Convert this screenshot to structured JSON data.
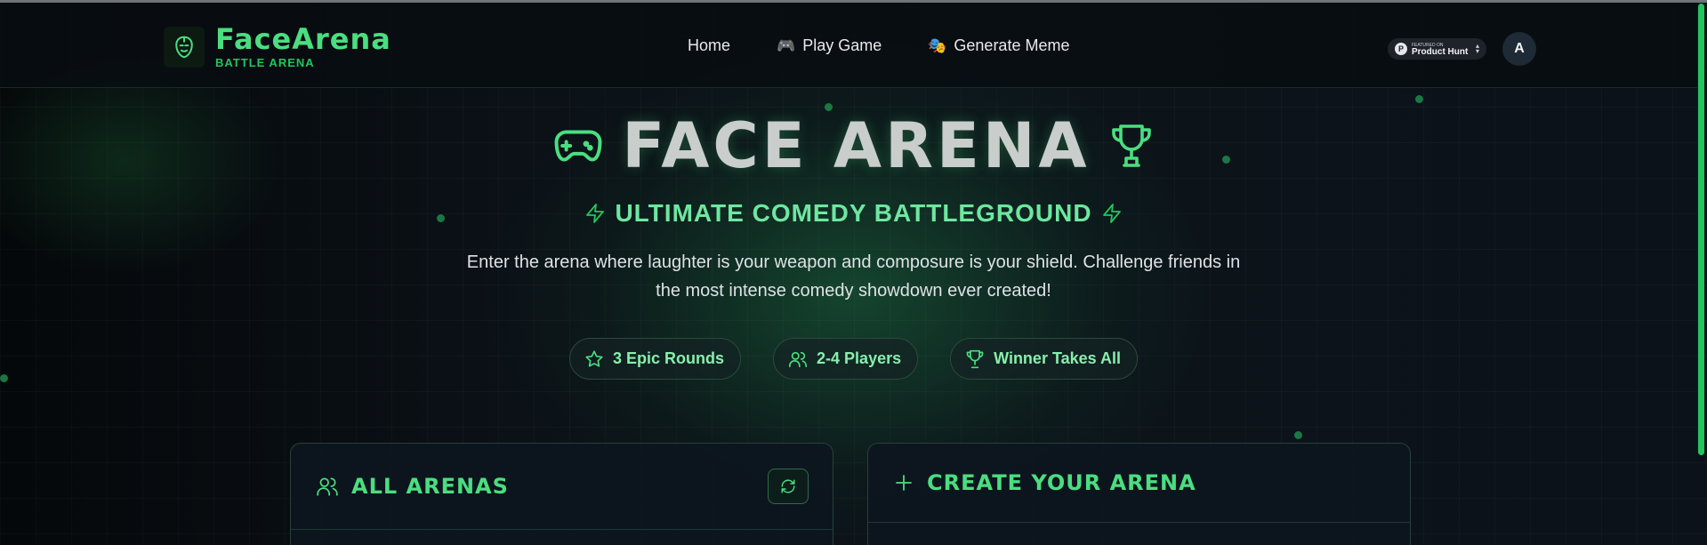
{
  "brand": {
    "title": "FaceArena",
    "subtitle": "BATTLE ARENA",
    "logo_icon": "mask-face-icon"
  },
  "nav": {
    "links": [
      {
        "label": "Home",
        "icon": ""
      },
      {
        "label": "Play Game",
        "icon": "🎮"
      },
      {
        "label": "Generate Meme",
        "icon": "🎭"
      }
    ]
  },
  "product_hunt": {
    "small_text": "FEATURED ON",
    "label": "Product Hunt",
    "logo_letter": "P",
    "arrows": "▲\n▼"
  },
  "user": {
    "avatar_letter": "A"
  },
  "hero": {
    "title": "FACE ARENA",
    "subtitle": "ULTIMATE COMEDY BATTLEGROUND",
    "description": "Enter the arena where laughter is your weapon and composure is your shield. Challenge friends in the most intense comedy showdown ever created!",
    "pills": [
      {
        "label": "3 Epic Rounds",
        "icon": "star-icon"
      },
      {
        "label": "2-4 Players",
        "icon": "users-icon"
      },
      {
        "label": "Winner Takes All",
        "icon": "trophy-icon"
      }
    ]
  },
  "panels": {
    "left": {
      "title": "ALL ARENAS",
      "icon": "users-icon",
      "action_icon": "refresh-icon"
    },
    "right": {
      "title": "CREATE YOUR ARENA",
      "icon": "plus-icon"
    }
  },
  "colors": {
    "accent": "#4ade80",
    "accent_dark": "#22c55e",
    "background": "#0b1117"
  }
}
